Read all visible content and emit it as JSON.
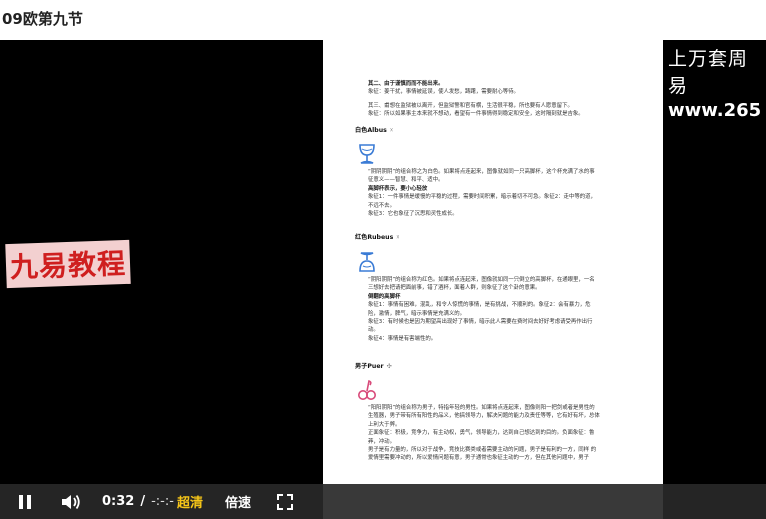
{
  "page": {
    "title": "09欧第九节"
  },
  "watermarks": {
    "left": "九易教程",
    "right_line1": "上万套周易",
    "right_line2": "www.265"
  },
  "document": {
    "para1": [
      {
        "text": "其二、由于谨慎而而不能出来。",
        "bold": true
      },
      {
        "text": "象征：姜干扰，事情被延误，使人发愁，踌躇，需要耐心等待。",
        "bold": false
      }
    ],
    "para2": [
      {
        "text": "其三、甫想在监狱被以离开，但监狱警和官有横，生活很平稳，所也要有人愿意留下。",
        "bold": false
      },
      {
        "text": "象征：所以如果事主本来就不想动，看望有一件事情得到稳定和安全，这时隔刻就是吉象。",
        "bold": false
      }
    ],
    "albus": {
      "title": "白色Albus",
      "lines": [
        {
          "text": "“阴阴阴阴”的组合称之为白色。如果将点连起来，图像就如同一只高脚杯，这个杯充满了水的事",
          "bold": false
        },
        {
          "text": "征意义——智慧、和平、适中。",
          "bold": false
        },
        {
          "text": "高脚杯表示，要小心轻放",
          "bold": true
        },
        {
          "text": "象征1：一件事情是缓慢的平稳的过程，需要时间积累，暗示着切不可急。象征2：走中等的道，",
          "bold": false
        },
        {
          "text": "不远不去。",
          "bold": false
        },
        {
          "text": "象征3：它也象征了沉思和灵性成长。",
          "bold": false
        }
      ]
    },
    "rubeus": {
      "title": "红色Rubeus",
      "lines": [
        {
          "text": "“阴阳阴阴”的组合称为红色。如果将点连起来，图像就如同一只倒立的高脚杯，在通眼里，一名",
          "bold": false
        },
        {
          "text": "三想好去把请把面前事，错了酒杯，面着人群，则象征了这个卦的意果。",
          "bold": false
        },
        {
          "text": "倒翻的高脚杯",
          "bold": true
        },
        {
          "text": "象征1：事情有困难，混乱，和令人惊慌的事情，是有挑战，不顺利的。象征2：会有暴力，危",
          "bold": false
        },
        {
          "text": "险，激情，脾气，暗示事情是充满义的。",
          "bold": false
        },
        {
          "text": "象征3：有时候也是因为期望高出现好了事情，暗示此人需要在费时间去好好考虑请受再作出行",
          "bold": false
        },
        {
          "text": "动。",
          "bold": false
        },
        {
          "text": "象征4：事情是有害端性的。",
          "bold": false
        }
      ]
    },
    "puer": {
      "title": "男子Puer",
      "lines": [
        {
          "text": "“阳阳阴阳”的组合称为男子，特指年轻的男性。如果将点连起来，图像则阳一把剑或者是男性的",
          "bold": false
        },
        {
          "text": "生殖器，男子带有所有阳性的品义，他搞领导力，解决问题的能力及责任等等，它有好有坏，总体",
          "bold": false
        },
        {
          "text": "上利大于弊。",
          "bold": false
        },
        {
          "text": "正面象征：积极，竞争力，有主动权，勇气，领导能力，达到自己想达到的目的。负面象征：鲁",
          "bold": false
        },
        {
          "text": "莽，冲动。",
          "bold": false
        },
        {
          "text": "男子是有力量的，所以对于战争，竞技比赛类或者需要主动的问题，男子是有利的一方，同样 的",
          "bold": false
        },
        {
          "text": "爱情里需要冲动的，所以爱情问题有意，男子通常也象征主动的一方，但在其他问题中，男子",
          "bold": false
        }
      ]
    }
  },
  "controls": {
    "current_time": "0:32",
    "separator": "/",
    "duration": "-:-:-",
    "quality": "超清",
    "speed": "倍速"
  },
  "colors": {
    "quality_accent": "#f5c518",
    "watermark_red": "#cf1f1f",
    "icon_blue": "#3a7bd5",
    "icon_pink": "#d84a7a"
  }
}
